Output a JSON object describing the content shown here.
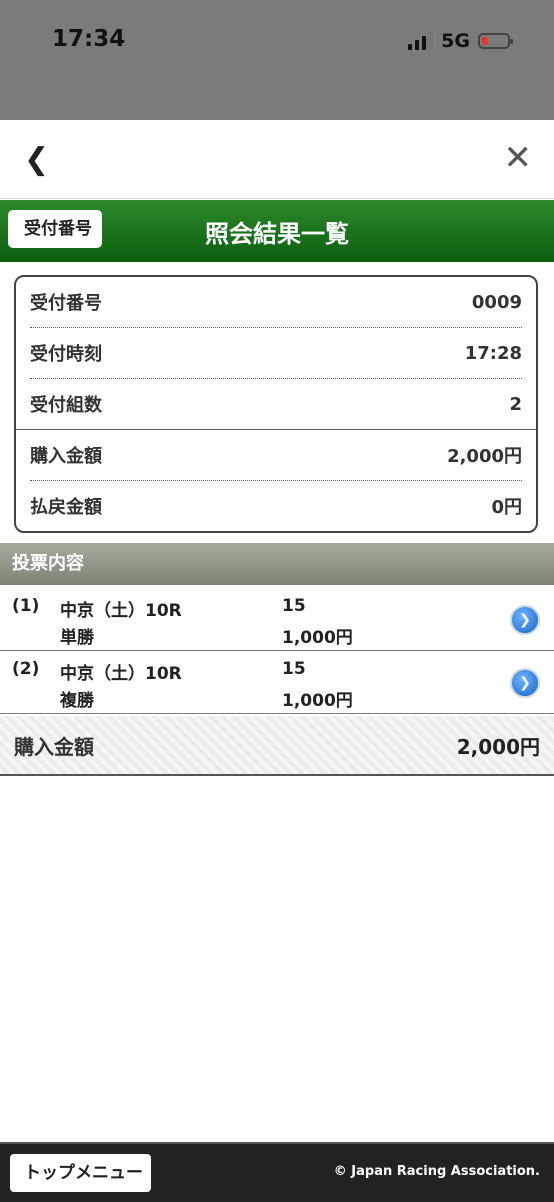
{
  "status_bar": {
    "time": "17:34",
    "network": "5G"
  },
  "nav": {
    "back_icon": "chevron-left-icon",
    "close_icon": "close-icon"
  },
  "header": {
    "back_label": "受付番号",
    "title": "照会結果一覧"
  },
  "info": {
    "rows": [
      {
        "label": "受付番号",
        "value": "0009"
      },
      {
        "label": "受付時刻",
        "value": "17:28"
      },
      {
        "label": "受付組数",
        "value": "2"
      },
      {
        "label": "購入金額",
        "value": "2,000円"
      },
      {
        "label": "払戻金額",
        "value": "0円"
      }
    ]
  },
  "section": {
    "title": "投票内容"
  },
  "bets": [
    {
      "num": "(1)",
      "race": "中京（土）10R",
      "type": "単勝",
      "horse": "15",
      "amount": "1,000円"
    },
    {
      "num": "(2)",
      "race": "中京（土）10R",
      "type": "複勝",
      "horse": "15",
      "amount": "1,000円"
    }
  ],
  "total": {
    "label": "購入金額",
    "value": "2,000円"
  },
  "footer": {
    "top_menu": "トップメニュー",
    "copyright": "© Japan Racing Association."
  },
  "colors": {
    "header_green": "#0d5e0d",
    "section_gray": "#7c8374",
    "detail_blue": "#1463c7"
  }
}
